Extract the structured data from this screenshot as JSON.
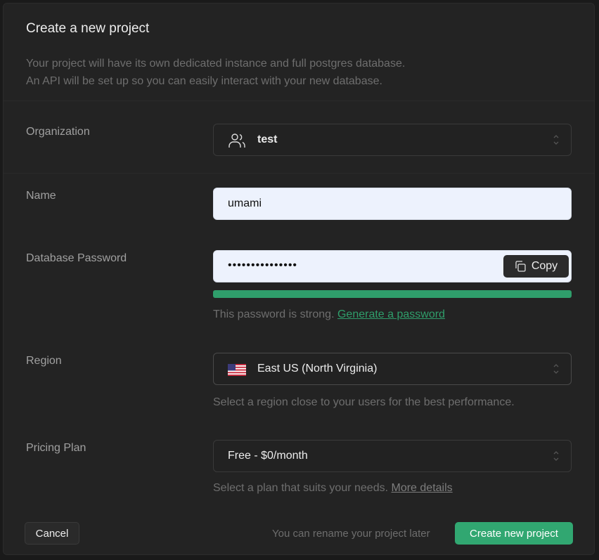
{
  "dialog": {
    "title": "Create a new project",
    "description_line1": "Your project will have its own dedicated instance and full postgres database.",
    "description_line2": "An API will be set up so you can easily interact with your new database."
  },
  "organization": {
    "label": "Organization",
    "value": "test",
    "icon": "users-icon"
  },
  "name": {
    "label": "Name",
    "value": "umami"
  },
  "password": {
    "label": "Database Password",
    "value": "•••••••••••••••",
    "copy_label": "Copy",
    "strength_percent": 100,
    "strength_text": "This password is strong.",
    "generate_link": "Generate a password"
  },
  "region": {
    "label": "Region",
    "value": "East US (North Virginia)",
    "hint": "Select a region close to your users for the best performance.",
    "icon": "us-flag-icon"
  },
  "pricing": {
    "label": "Pricing Plan",
    "value": "Free - $0/month",
    "hint": "Select a plan that suits your needs.",
    "more_link": "More details"
  },
  "footer": {
    "cancel_label": "Cancel",
    "note": "You can rename your project later",
    "create_label": "Create new project"
  },
  "colors": {
    "accent": "#31a771",
    "background": "#232323"
  }
}
